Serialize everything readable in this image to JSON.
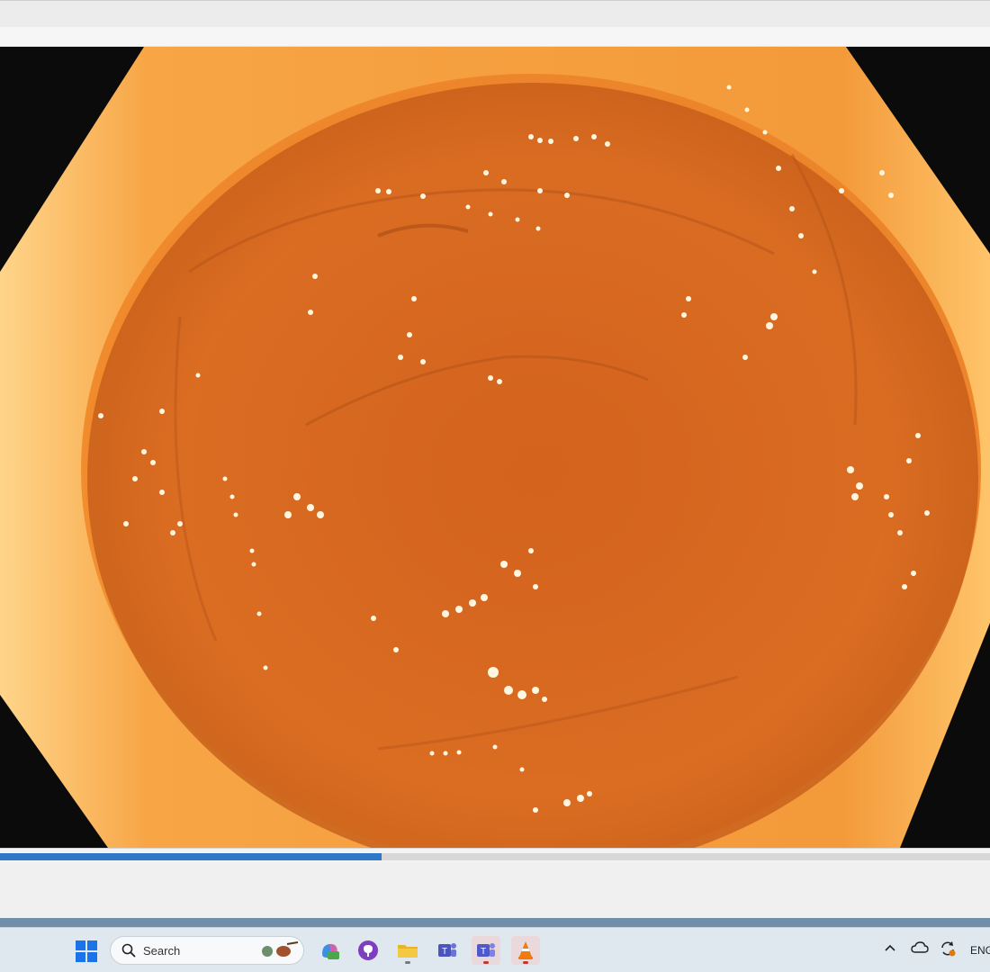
{
  "player": {
    "progress_fraction": 0.385,
    "accent_color": "#2f78c8"
  },
  "taskbar": {
    "search_label": "Search",
    "icons": [
      "start-icon",
      "copilot-icon",
      "github-icon",
      "file-explorer-icon",
      "teams-classic-icon",
      "teams-icon",
      "vlc-icon"
    ],
    "tray": {
      "language": "ENG"
    }
  }
}
